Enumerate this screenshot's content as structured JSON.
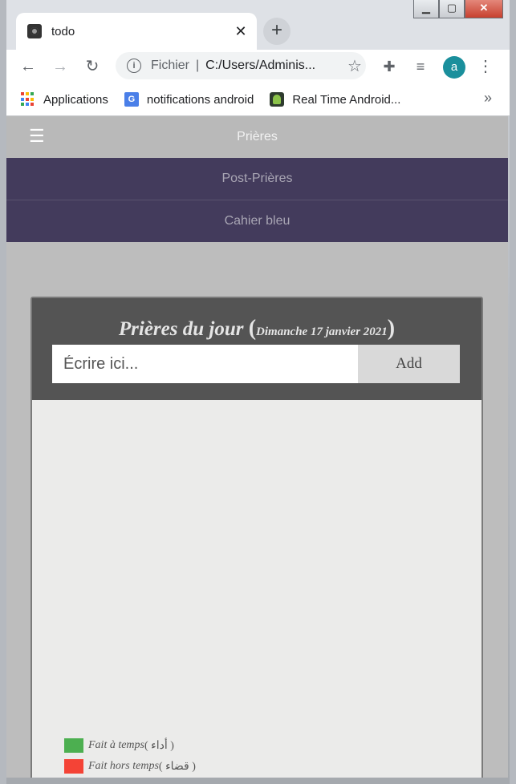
{
  "browser": {
    "tab_title": "todo",
    "tab_close": "✕",
    "new_tab": "+",
    "url_scheme": "Fichier",
    "url_sep": "|",
    "url_text": "C:/Users/Adminis...",
    "avatar_letter": "a",
    "window_buttons": {
      "minimize": "▁",
      "maximize": "▢",
      "close": "✕"
    },
    "bookmarks": [
      {
        "label": "Applications",
        "icon": "apps-grid-icon"
      },
      {
        "label": "notifications android",
        "icon": "google-translate-icon"
      },
      {
        "label": "Real Time Android...",
        "icon": "android-icon"
      }
    ],
    "bookmarks_more": "»"
  },
  "app": {
    "header_title": "Prières",
    "menu_icon": "☰",
    "nav": [
      "Post-Prières",
      "Cahier bleu"
    ],
    "nav_color": "#433b5c"
  },
  "card": {
    "title": "Prières du jour",
    "paren_open": "(",
    "date": "Dimanche 17 janvier 2021",
    "paren_close": ")",
    "input_placeholder": "Écrire ici...",
    "add_label": "Add"
  },
  "legend": [
    {
      "label": "Fait à temps",
      "arabic": "( أداء )",
      "color": "#4caf50"
    },
    {
      "label": "Fait hors temps",
      "arabic": "( قضاء )",
      "color": "#f44336"
    }
  ]
}
